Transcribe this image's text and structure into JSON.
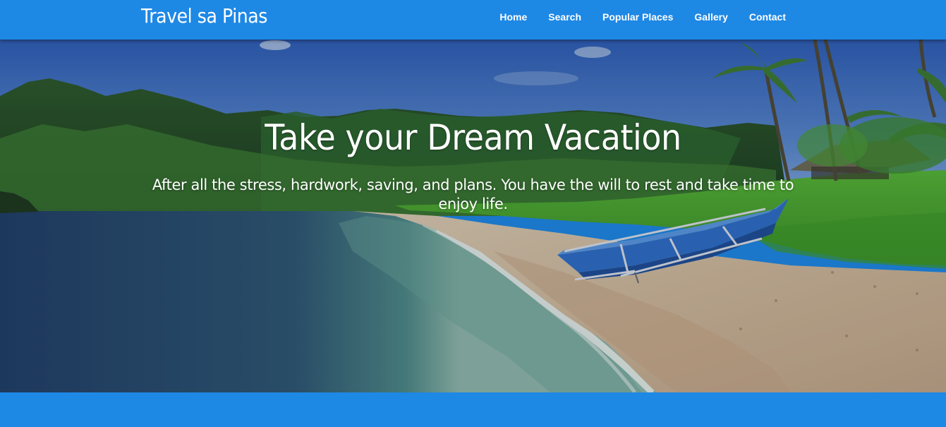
{
  "header": {
    "brand": "Travel sa Pinas",
    "nav": [
      {
        "label": "Home"
      },
      {
        "label": "Search"
      },
      {
        "label": "Popular Places"
      },
      {
        "label": "Gallery"
      },
      {
        "label": "Contact"
      }
    ]
  },
  "hero": {
    "title": "Take your Dream Vacation",
    "subtitle": "After all the stress, hardwork, saving, and plans. You have the will to rest and take time to enjoy life."
  },
  "colors": {
    "primary": "#1e88e5",
    "text": "#ffffff"
  }
}
